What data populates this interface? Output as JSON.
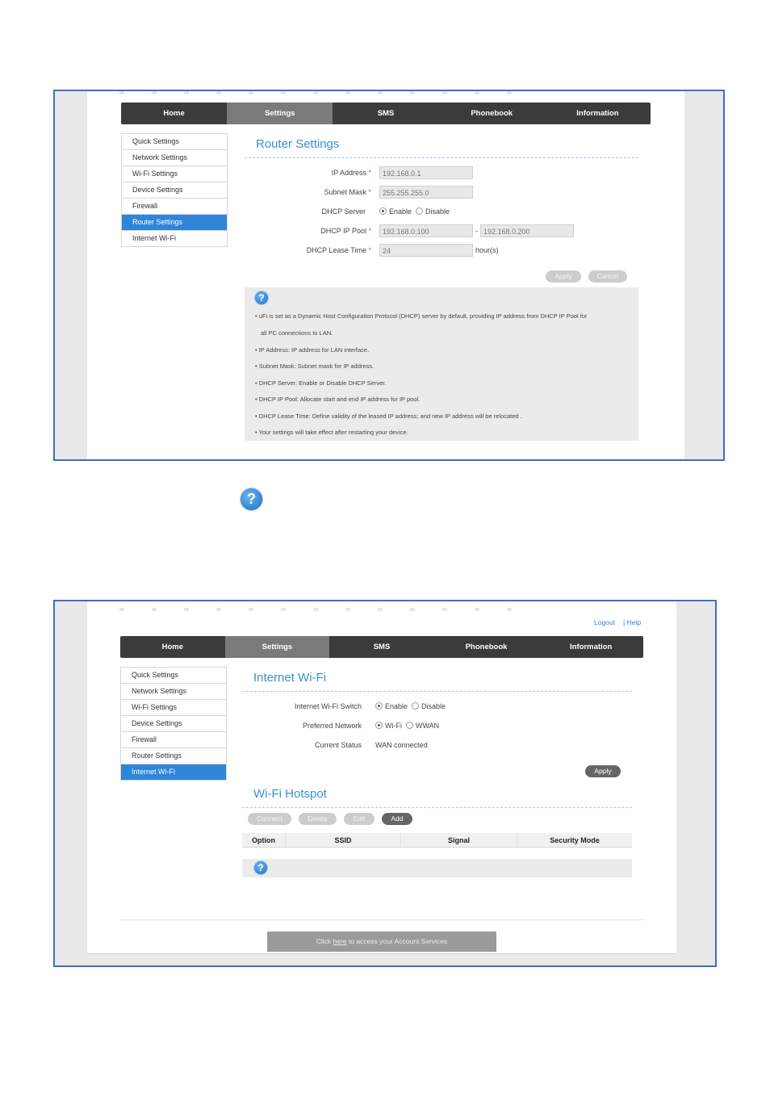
{
  "router_screen": {
    "nav": [
      "Home",
      "Settings",
      "SMS",
      "Phonebook",
      "Information"
    ],
    "active_nav": 1,
    "menu": [
      "Quick Settings",
      "Network Settings",
      "Wi-Fi Settings",
      "Device Settings",
      "Firewall",
      "Router Settings",
      "Internet Wi-Fi"
    ],
    "active_menu": 5,
    "title": "Router Settings",
    "form": {
      "ip_label": "IP Address",
      "ip_value": "192.168.0.1",
      "mask_label": "Subnet Mask",
      "mask_value": "255.255.255.0",
      "dhcp_label": "DHCP Server",
      "dhcp_enable": "Enable",
      "dhcp_disable": "Disable",
      "pool_label": "DHCP IP Pool",
      "pool_start": "192.168.0.100",
      "pool_sep": "-",
      "pool_end": "192.168.0.200",
      "lease_label": "DHCP Lease Time",
      "lease_value": "24",
      "lease_unit": "hour(s)",
      "required_mark": "*"
    },
    "apply": "Apply",
    "cancel": "Cancel",
    "help_icon": "?",
    "help": [
      "• uFi is set as a Dynamic Host Configuration Protocol (DHCP) server by default, providing IP address from DHCP IP Pool for",
      "all PC connections to LAN.",
      "• IP Address: IP address for LAN interface.",
      "• Subnet Mask: Subnet mask for IP address.",
      "• DHCP Server: Enable or Disable DHCP Server.",
      "• DHCP IP Pool: Allocate start and end IP address for IP pool.",
      "• DHCP Lease Time: Define validity of the leased IP address; and new IP address will be relocated .",
      "• Your settings will take effect after restarting your device."
    ]
  },
  "standalone_help_icon": "?",
  "internet_screen": {
    "logout": "Logout",
    "help_link": "| Help",
    "nav": [
      "Home",
      "Settings",
      "SMS",
      "Phonebook",
      "Information"
    ],
    "active_nav": 1,
    "menu": [
      "Quick Settings",
      "Network Settings",
      "Wi-Fi Settings",
      "Device Settings",
      "Firewall",
      "Router Settings",
      "Internet Wi-Fi"
    ],
    "active_menu": 6,
    "title": "Internet Wi-Fi",
    "switch_label": "Internet Wi-Fi Switch",
    "switch_enable": "Enable",
    "switch_disable": "Disable",
    "pref_label": "Preferred Network",
    "pref_wifi": "Wi-Fi",
    "pref_wwan": "WWAN",
    "status_label": "Current Status",
    "status_value": "WAN connected",
    "apply": "Apply",
    "hotspot_title": "Wi-Fi Hotspot",
    "buttons": [
      "Connect",
      "Delete",
      "Edit",
      "Add"
    ],
    "columns": [
      "Option",
      "SSID",
      "Signal",
      "Security Mode"
    ],
    "help_icon": "?",
    "footer_pre": "Click ",
    "footer_link": "here",
    "footer_post": " to access your Account Services"
  }
}
